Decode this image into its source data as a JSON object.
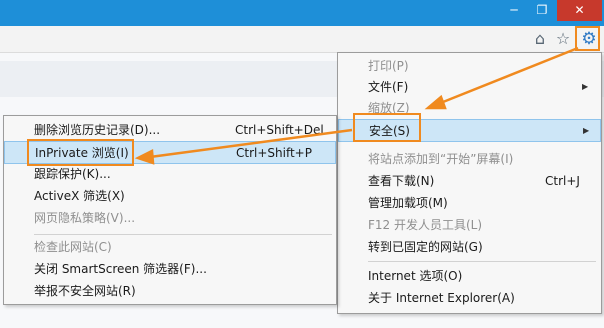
{
  "window": {
    "minimize_glyph": "─",
    "maximize_glyph": "❐",
    "close_glyph": "✕"
  },
  "toolbar": {
    "home_icon": "⌂",
    "favorites_icon": "☆",
    "tools_icon": "⚙"
  },
  "tools_menu": {
    "items": [
      {
        "label": "打印(P)",
        "disabled": true
      },
      {
        "label": "文件(F)",
        "submenu": true
      },
      {
        "label": "缩放(Z)",
        "disabled": true
      },
      {
        "label": "安全(S)",
        "submenu": true,
        "highlighted": true
      },
      {
        "label": "将站点添加到“开始”屏幕(I)",
        "disabled": true
      },
      {
        "label": "查看下载(N)",
        "shortcut": "Ctrl+J"
      },
      {
        "label": "管理加载项(M)"
      },
      {
        "label": "F12 开发人员工具(L)",
        "disabled": true
      },
      {
        "label": "转到已固定的网站(G)"
      },
      {
        "label": "Internet 选项(O)"
      },
      {
        "label": "关于 Internet Explorer(A)"
      }
    ]
  },
  "safety_menu": {
    "items": [
      {
        "label": "删除浏览历史记录(D)...",
        "shortcut": "Ctrl+Shift+Del"
      },
      {
        "label": "InPrivate 浏览(I)",
        "shortcut": "Ctrl+Shift+P",
        "highlighted": true
      },
      {
        "label": "跟踪保护(K)..."
      },
      {
        "label": "ActiveX 筛选(X)"
      },
      {
        "label": "网页隐私策略(V)...",
        "disabled": true
      },
      {
        "label": "检查此网站(C)",
        "disabled": true
      },
      {
        "label": "关闭 SmartScreen 筛选器(F)..."
      },
      {
        "label": "举报不安全网站(R)"
      }
    ]
  },
  "colors": {
    "titlebar": "#1e8fd8",
    "close_button": "#c7392c",
    "annotation_orange": "#f08a1f",
    "highlight": "#cde6f7"
  }
}
